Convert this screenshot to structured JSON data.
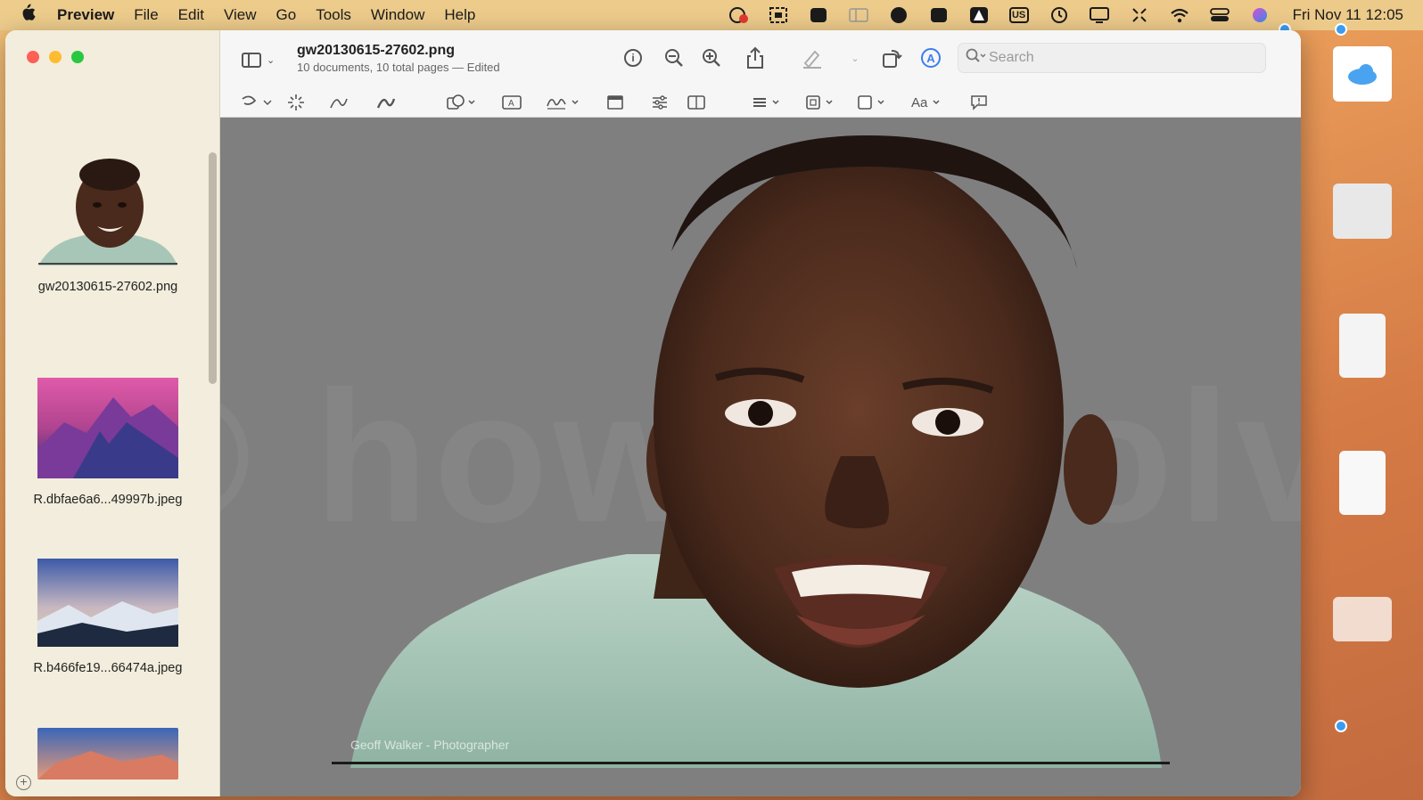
{
  "menubar": {
    "app_name": "Preview",
    "items": [
      "File",
      "Edit",
      "View",
      "Go",
      "Tools",
      "Window",
      "Help"
    ],
    "keyboard_layout": "US",
    "clock": "Fri Nov 11  12:05"
  },
  "window": {
    "doc_title": "gw20130615-27602.png",
    "doc_subtitle": "10 documents, 10 total pages — Edited",
    "search_placeholder": "Search"
  },
  "sidebar": {
    "items": [
      {
        "name": "gw20130615-27602.png"
      },
      {
        "name": "R.dbfae6a6...49997b.jpeg"
      },
      {
        "name": "R.b466fe19...66474a.jpeg"
      }
    ]
  },
  "canvas": {
    "photo_credit": "Geoff Walker - Photographer",
    "watermark": "© howtoisolve.com"
  },
  "colors": {
    "canvas_bg": "#7f7f80",
    "accent": "#3b7df0"
  }
}
